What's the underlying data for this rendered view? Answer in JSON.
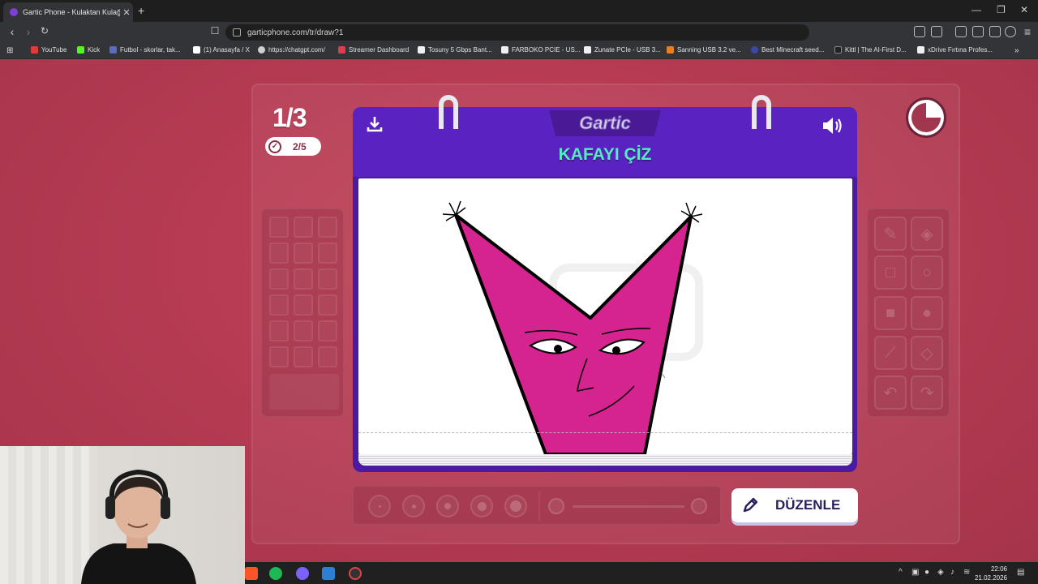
{
  "browser": {
    "tab_title": "Gartic Phone - Kulaktan Kulağa",
    "url": "garticphone.com/tr/draw?1"
  },
  "bookmarks": [
    {
      "label": "YouTube",
      "color": "#e53935"
    },
    {
      "label": "Kick",
      "color": "#53fc18"
    },
    {
      "label": "Futbol - skorlar, tak...",
      "color": "#5c6bc0"
    },
    {
      "label": "(1) Anasayfa / X",
      "color": "#ffffff"
    },
    {
      "label": "https://chatgpt.com/",
      "color": "#cfcfcf"
    },
    {
      "label": "Streamer Dashboard",
      "color": "#e53950"
    },
    {
      "label": "Tosuny 5 Gbps Bant...",
      "color": "#f0f0f0"
    },
    {
      "label": "FARBOKO PCIE - US...",
      "color": "#f0f0f0"
    },
    {
      "label": "Zunate PCIe - USB 3...",
      "color": "#f0f0f0"
    },
    {
      "label": "Sanning USB 3.2 ve...",
      "color": "#e67e22"
    },
    {
      "label": "Best Minecraft seed...",
      "color": "#3949ab"
    },
    {
      "label": "Kittl | The AI-First D...",
      "color": "#222222"
    },
    {
      "label": "xDrive Fırtına Profes...",
      "color": "#f0f0f0"
    }
  ],
  "game": {
    "round": "1/3",
    "done_count": "2/5",
    "logo": "Gartic",
    "prompt": "KAFAYI ÇİZ",
    "edit_button": "DÜZENLE",
    "timer_elapsed_fraction": 0.25,
    "brand_color": "#5a22c0",
    "prompt_color": "#56ecc3"
  },
  "taskbar": {
    "time": "22:06",
    "date": "21.02.2026"
  }
}
